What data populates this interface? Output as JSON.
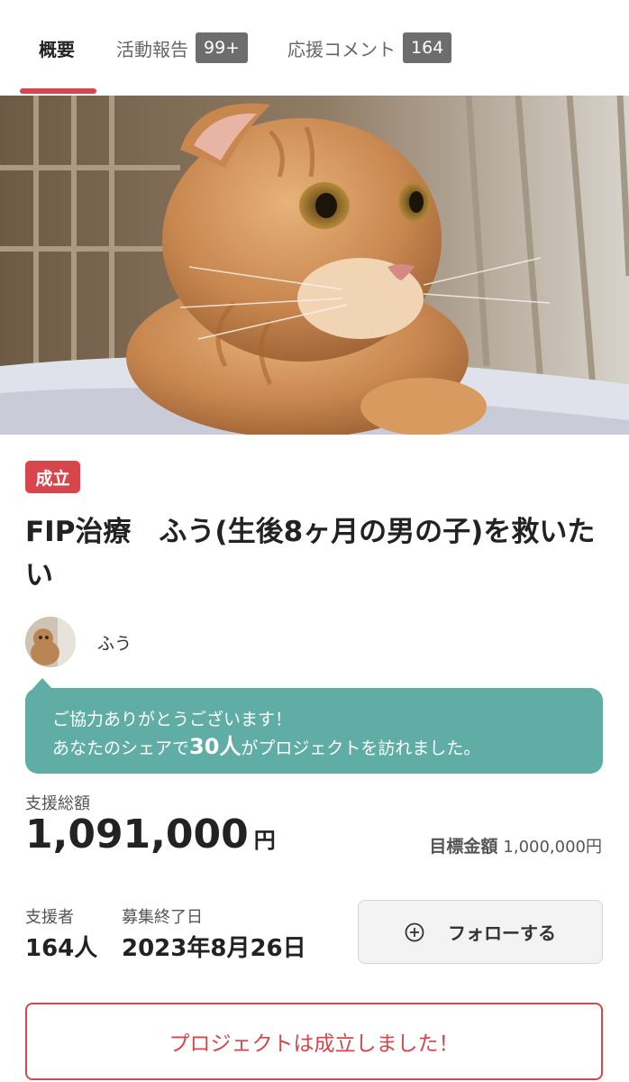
{
  "tabs": [
    {
      "label": "概要"
    },
    {
      "label": "活動報告",
      "count": "99+"
    },
    {
      "label": "応援コメント",
      "count": "164"
    }
  ],
  "project": {
    "status_badge": "成立",
    "title": "FIP治療　ふう(生後8ヶ月の男の子)を救いたい",
    "owner_name": "ふう"
  },
  "share_banner": {
    "line1": "ご協力ありがとうございます！",
    "line2_prefix": "あなたのシェアで",
    "line2_count": "30人",
    "line2_suffix": "がプロジェクトを訪れました。"
  },
  "funding": {
    "total_label": "支援総額",
    "total_value": "1,091,000",
    "total_unit": "円",
    "goal_label": "目標金額",
    "goal_value": "1,000,000円",
    "supporters_label": "支援者",
    "supporters_value": "164人",
    "end_label": "募集終了日",
    "end_value": "2023年8月26日"
  },
  "actions": {
    "follow_label": "フォローする",
    "success_label": "プロジェクトは成立しました！"
  },
  "icons": {
    "follow": "plus-circle-icon"
  },
  "colors": {
    "accent_red": "#d7464d",
    "teal": "#5fada4",
    "badge_gray": "#6d6d6d"
  }
}
